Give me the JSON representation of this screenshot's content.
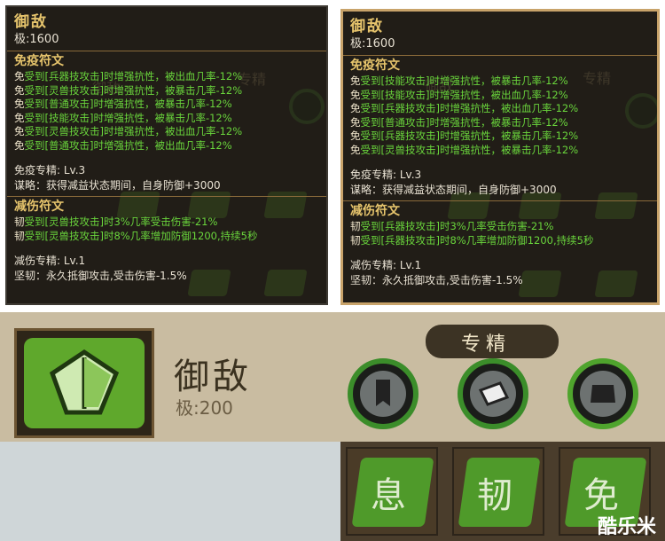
{
  "left_panel": {
    "title": "御敌",
    "level": "极:1600",
    "immune_section": "免疫符文",
    "immune_lines": [
      {
        "tag": "免",
        "text": "受到[兵器技攻击]时增强抗性，被出血几率-12%"
      },
      {
        "tag": "免",
        "text": "受到[灵兽技攻击]时增强抗性，被暴击几率-12%"
      },
      {
        "tag": "免",
        "text": "受到[普通攻击]时增强抗性，被暴击几率-12%"
      },
      {
        "tag": "免",
        "text": "受到[技能攻击]时增强抗性，被暴击几率-12%"
      },
      {
        "tag": "免",
        "text": "受到[灵兽技攻击]时增强抗性，被出血几率-12%"
      },
      {
        "tag": "免",
        "text": "受到[普通攻击]时增强抗性，被出血几率-12%"
      }
    ],
    "immune_mastery": "免疫专精: Lv.3",
    "immune_mastery_desc": "谋略：获得减益状态期间，自身防御+3000",
    "reduce_section": "减伤符文",
    "reduce_lines": [
      {
        "tag": "韧",
        "text": "受到[灵兽技攻击]时3%几率受击伤害-21%"
      },
      {
        "tag": "韧",
        "text": "受到[灵兽技攻击]时8%几率增加防御1200,持续5秒"
      }
    ],
    "reduce_mastery": "减伤专精: Lv.1",
    "reduce_mastery_desc": "坚韧：永久抵御攻击,受击伤害-1.5%"
  },
  "right_panel": {
    "title": "御敌",
    "level": "极:1600",
    "immune_section": "免疫符文",
    "immune_lines": [
      {
        "tag": "免",
        "text": "受到[技能攻击]时增强抗性，被暴击几率-12%"
      },
      {
        "tag": "免",
        "text": "受到[技能攻击]时增强抗性，被出血几率-12%"
      },
      {
        "tag": "免",
        "text": "受到[兵器技攻击]时增强抗性，被出血几率-12%"
      },
      {
        "tag": "免",
        "text": "受到[普通攻击]时增强抗性，被暴击几率-12%"
      },
      {
        "tag": "免",
        "text": "受到[兵器技攻击]时增强抗性，被暴击几率-12%"
      },
      {
        "tag": "免",
        "text": "受到[灵兽技攻击]时增强抗性，被暴击几率-12%"
      }
    ],
    "immune_mastery": "免疫专精: Lv.3",
    "immune_mastery_desc": "谋略：获得减益状态期间，自身防御+3000",
    "reduce_section": "减伤符文",
    "reduce_lines": [
      {
        "tag": "韧",
        "text": "受到[兵器技攻击]时3%几率受击伤害-21%"
      },
      {
        "tag": "韧",
        "text": "受到[兵器技攻击]时8%几率增加防御1200,持续5秒"
      }
    ],
    "reduce_mastery": "减伤专精: Lv.1",
    "reduce_mastery_desc": "坚韧：永久抵御攻击,受击伤害-1.5%"
  },
  "bottom": {
    "title": "御敌",
    "level": "极:200",
    "tab": "专精",
    "rune_chars": [
      "息",
      "韧",
      "免"
    ],
    "watermark": "酷乐米"
  },
  "colors": {
    "accent": "#e6c46c",
    "effect_text": "#6ad63c",
    "rune_green": "#5fa82c"
  }
}
